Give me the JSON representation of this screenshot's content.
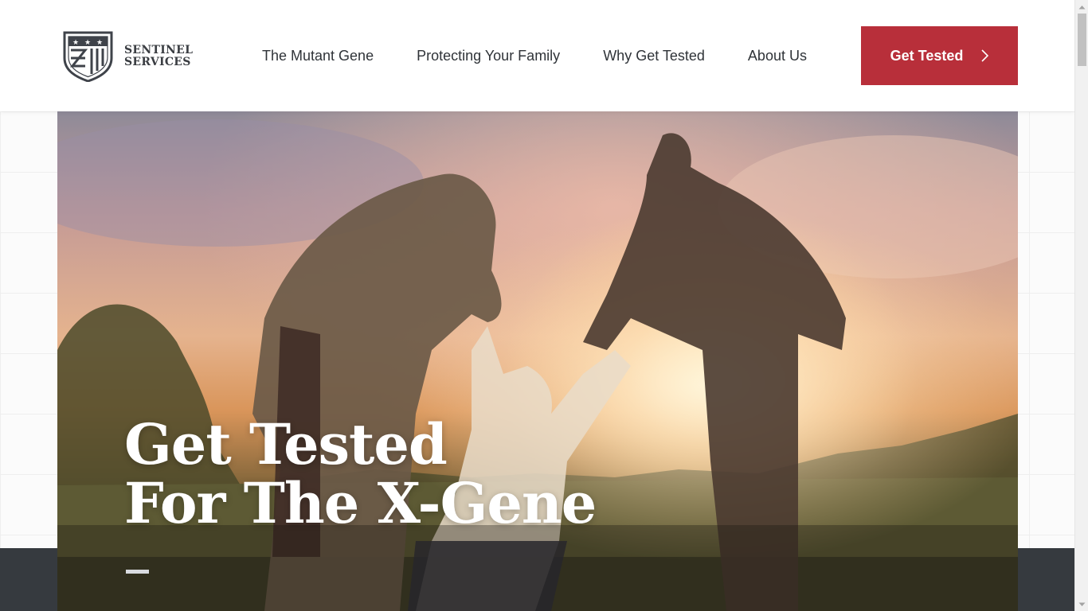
{
  "brand": {
    "line1": "SENTINEL",
    "line2": "SERVICES",
    "icon": "shield-logo-icon"
  },
  "nav": {
    "items": [
      {
        "label": "The Mutant Gene"
      },
      {
        "label": "Protecting Your Family"
      },
      {
        "label": "Why Get Tested"
      },
      {
        "label": "About Us"
      }
    ]
  },
  "cta": {
    "label": "Get Tested",
    "icon": "chevron-right-icon"
  },
  "hero": {
    "title_line1": "Get Tested",
    "title_line2": "For The X-Gene",
    "image": "family-silhouette-sunset-photo"
  },
  "colors": {
    "accent": "#b82f3a",
    "text_dark": "#2f3338",
    "band": "#363a3f"
  }
}
